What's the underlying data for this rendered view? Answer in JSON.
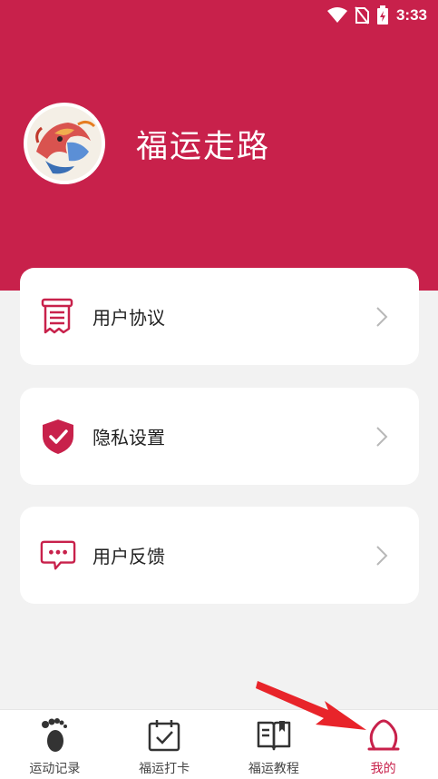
{
  "status_bar": {
    "time": "3:33",
    "icons": [
      "wifi-icon",
      "no-sim-icon",
      "battery-charging-icon"
    ]
  },
  "profile": {
    "app_name": "福运走路",
    "avatar_icon": "dragon-avatar"
  },
  "menu": [
    {
      "label": "用户协议",
      "icon": "document-icon"
    },
    {
      "label": "隐私设置",
      "icon": "shield-check-icon"
    },
    {
      "label": "用户反馈",
      "icon": "chat-bubble-icon"
    }
  ],
  "tabs": [
    {
      "label": "运动记录",
      "icon": "footprint-icon",
      "active": false
    },
    {
      "label": "福运打卡",
      "icon": "calendar-check-icon",
      "active": false
    },
    {
      "label": "福运教程",
      "icon": "book-icon",
      "active": false
    },
    {
      "label": "我的",
      "icon": "user-icon",
      "active": true
    }
  ],
  "colors": {
    "primary": "#c8214b",
    "background": "#f2f2f2",
    "card": "#ffffff",
    "annotation_arrow": "#e8242a"
  }
}
